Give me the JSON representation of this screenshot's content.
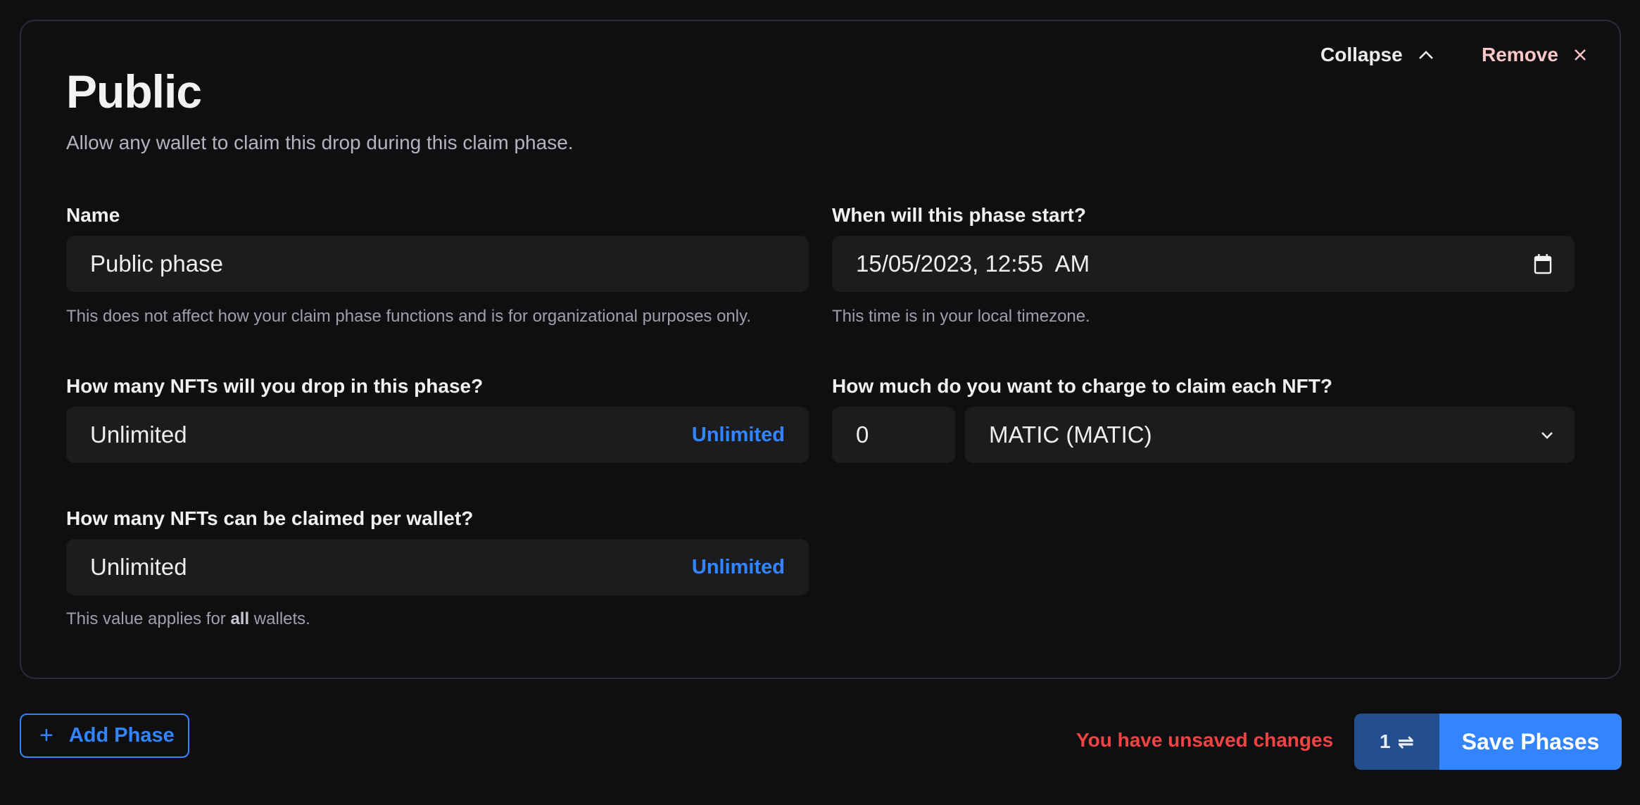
{
  "card": {
    "title": "Public",
    "subtitle": "Allow any wallet to claim this drop during this claim phase.",
    "collapse_label": "Collapse",
    "remove_label": "Remove"
  },
  "fields": {
    "name": {
      "label": "Name",
      "value": "Public phase",
      "helper": "This does not affect how your claim phase functions and is for organizational purposes only."
    },
    "start": {
      "label": "When will this phase start?",
      "value": "15/05/2023, 12:55  AM",
      "helper": "This time is in your local timezone."
    },
    "drop_count": {
      "label": "How many NFTs will you drop in this phase?",
      "value": "Unlimited",
      "link": "Unlimited"
    },
    "price": {
      "label": "How much do you want to charge to claim each NFT?",
      "amount": "0",
      "currency": "MATIC (MATIC)"
    },
    "per_wallet": {
      "label": "How many NFTs can be claimed per wallet?",
      "value": "Unlimited",
      "link": "Unlimited",
      "helper_prefix": "This value applies for ",
      "helper_bold": "all",
      "helper_suffix": " wallets."
    }
  },
  "footer": {
    "add_phase_label": "Add Phase",
    "unsaved_text": "You have unsaved changes",
    "changes_count": "1",
    "save_label": "Save Phases"
  },
  "colors": {
    "accent": "#3385ff",
    "danger": "#ef4444",
    "remove": "#fcc7c7",
    "background": "#0f0f12",
    "input_bg": "#1c1c1f"
  }
}
